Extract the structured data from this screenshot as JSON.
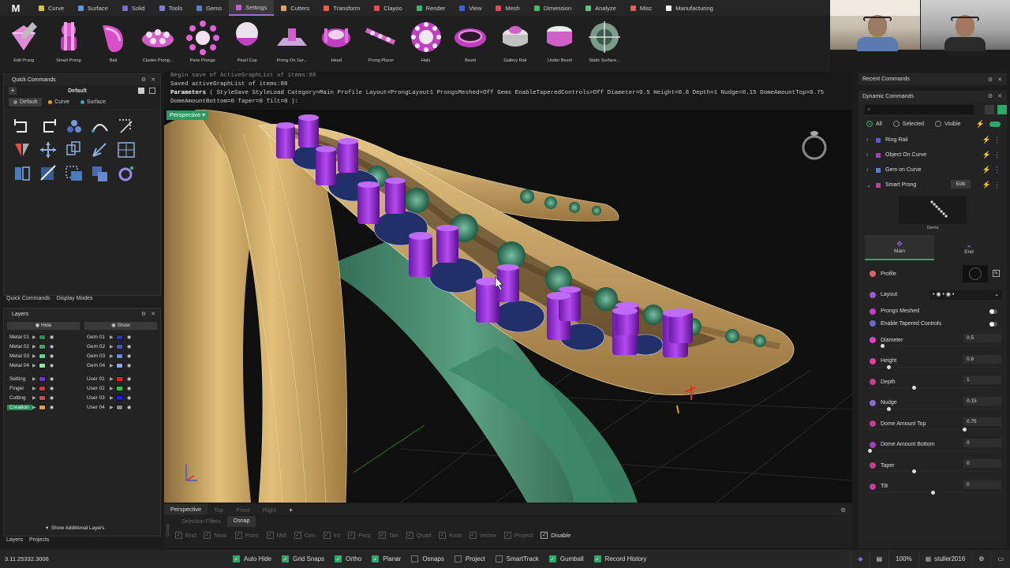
{
  "menu": {
    "logo": "M",
    "tabs": [
      {
        "label": "Curve",
        "color": "#e0c040"
      },
      {
        "label": "Surface",
        "color": "#5a9ad8"
      },
      {
        "label": "Solid",
        "color": "#7a6ad8"
      },
      {
        "label": "Tools",
        "color": "#7a7ad8"
      },
      {
        "label": "Gems",
        "color": "#5a7ad8"
      },
      {
        "label": "Settings",
        "color": "#c060d0"
      },
      {
        "label": "Cutters",
        "color": "#e0a060"
      },
      {
        "label": "Transform",
        "color": "#e06040"
      },
      {
        "label": "Clayoo",
        "color": "#e05050"
      },
      {
        "label": "Render",
        "color": "#40b070"
      },
      {
        "label": "View",
        "color": "#4060d0"
      },
      {
        "label": "Mesh",
        "color": "#d05060"
      },
      {
        "label": "Dimension",
        "color": "#40c060"
      },
      {
        "label": "Analyze",
        "color": "#60c080"
      },
      {
        "label": "Misc",
        "color": "#e06060"
      },
      {
        "label": "Manufacturing",
        "color": "#ffffff"
      }
    ],
    "active_index": 5
  },
  "ribbon": {
    "tools": [
      {
        "label": "Edit Prong",
        "icon": "edit-prong-icon"
      },
      {
        "label": "Smart Prong",
        "icon": "smart-prong-icon"
      },
      {
        "label": "Bail",
        "icon": "bail-icon"
      },
      {
        "label": "Cluster Prong...",
        "icon": "cluster-prong-icon"
      },
      {
        "label": "Pave Prongs",
        "icon": "pave-prongs-icon"
      },
      {
        "label": "Pearl Cup",
        "icon": "pearl-cup-icon"
      },
      {
        "label": "Prong On Sur...",
        "icon": "prong-on-surface-icon"
      },
      {
        "label": "Head",
        "icon": "head-icon"
      },
      {
        "label": "Prong Placer",
        "icon": "prong-placer-icon"
      },
      {
        "label": "Halo",
        "icon": "halo-icon"
      },
      {
        "label": "Bezel",
        "icon": "bezel-icon"
      },
      {
        "label": "Gallery Rail",
        "icon": "gallery-rail-icon"
      },
      {
        "label": "Under Bezel",
        "icon": "under-bezel-icon"
      },
      {
        "label": "Static Surface...",
        "icon": "static-surface-icon"
      }
    ]
  },
  "quick_commands": {
    "title": "Quick Commands",
    "preset": "Default",
    "tabs": [
      {
        "label": "Default",
        "color": "#888888"
      },
      {
        "label": "Curve",
        "color": "#e0a030"
      },
      {
        "label": "Surface",
        "color": "#3aa0c0"
      }
    ],
    "footer_tabs": [
      "Quick Commands",
      "Display Modes"
    ]
  },
  "layers": {
    "title": "Layers",
    "hide_label": "Hide",
    "show_label": "Show",
    "left": [
      {
        "name": "Metal 01",
        "color": "#2e8b57"
      },
      {
        "name": "Metal 02",
        "color": "#3aa86a"
      },
      {
        "name": "Metal 03",
        "color": "#5fd18a"
      },
      {
        "name": "Metal 04",
        "color": "#8be89f"
      },
      {
        "name": "Setting",
        "color": "#7a2ad0"
      },
      {
        "name": "Finger",
        "color": "#c04040"
      },
      {
        "name": "Cutting",
        "color": "#c05050"
      },
      {
        "name": "Creation",
        "color": "#e0a040"
      }
    ],
    "right": [
      {
        "name": "Gem 01",
        "color": "#2a3a9a"
      },
      {
        "name": "Gem 02",
        "color": "#3a5ad0"
      },
      {
        "name": "Gem 03",
        "color": "#6a8ae0"
      },
      {
        "name": "Gem 04",
        "color": "#8aaaf0"
      },
      {
        "name": "User 01",
        "color": "#e02020"
      },
      {
        "name": "User 02",
        "color": "#20d020"
      },
      {
        "name": "User 03",
        "color": "#2020e0"
      },
      {
        "name": "User 04",
        "color": "#888888"
      }
    ],
    "show_additional": "Show Additional Layers",
    "bottom_tabs": [
      "Layers",
      "Projects"
    ]
  },
  "command_line": {
    "line1": "Begin save of ActiveGraphList of items:88",
    "line2": "Saved activeGraphList of items:88",
    "param_label": "Parameters",
    "line3": "( StyleSave  StyleLoad  Category=Main  Profile  Layout=ProngLayout1  ProngsMeshed=Off  Gems  EnableTaperedControls=Off  Diameter=0.5  Height=0.8  Depth=1  Nudge=0.15  DomeAmountTop=0.75",
    "line4": "DomeAmountBottom=0  Taper=0  Tilt=0 ):"
  },
  "viewport": {
    "label": "Perspective",
    "tabs": [
      "Perspective",
      "Top",
      "Front",
      "Right"
    ],
    "add_tab": "+"
  },
  "snap_bar": {
    "tabs": [
      "Selection Filters",
      "Osnap"
    ],
    "side_label": "Osnap",
    "items": [
      {
        "label": "End",
        "on": false
      },
      {
        "label": "Near",
        "on": false
      },
      {
        "label": "Point",
        "on": false
      },
      {
        "label": "Mid",
        "on": false
      },
      {
        "label": "Cen",
        "on": false
      },
      {
        "label": "Int",
        "on": false
      },
      {
        "label": "Perp",
        "on": false
      },
      {
        "label": "Tan",
        "on": false
      },
      {
        "label": "Quad",
        "on": false
      },
      {
        "label": "Knot",
        "on": false
      },
      {
        "label": "Vertex",
        "on": false
      },
      {
        "label": "Project",
        "on": false
      },
      {
        "label": "Disable",
        "on": true
      }
    ]
  },
  "right_panel": {
    "recent_title": "Recent Commands",
    "dynamic_title": "Dynamic Commands",
    "filters": [
      {
        "label": "All",
        "on": true
      },
      {
        "label": "Selected",
        "on": false
      },
      {
        "label": "Visible",
        "on": false
      }
    ],
    "commands": [
      {
        "label": "Ring Rail",
        "color": "#5a5ad0",
        "expanded": false
      },
      {
        "label": "Object On Curve",
        "color": "#a040c0",
        "expanded": false
      },
      {
        "label": "Gem on Curve",
        "color": "#4a80d0",
        "expanded": false
      },
      {
        "label": "Smart Prong",
        "color": "#c040a0",
        "expanded": true
      }
    ],
    "edit_label": "Edit",
    "thumb_caption": "Gems",
    "main_tab": "Main",
    "end_tab": "End",
    "params": [
      {
        "label": "Profile",
        "kind": "profile",
        "icon_color": "#e06070"
      },
      {
        "label": "Layout",
        "kind": "layout",
        "icon_color": "#9a5ad0"
      },
      {
        "label": "Prongs Meshed",
        "kind": "toggle",
        "icon_color": "#c040c0"
      },
      {
        "label": "Enable Tapered Controls",
        "kind": "toggle",
        "icon_color": "#6a6ad0"
      },
      {
        "label": "Diameter",
        "value": "0.5",
        "slider": 0.1,
        "icon_color": "#e040c0"
      },
      {
        "label": "Height",
        "value": "0.8",
        "slider": 0.15,
        "icon_color": "#e040a0"
      },
      {
        "label": "Depth",
        "value": "1",
        "slider": 0.35,
        "icon_color": "#c04090"
      },
      {
        "label": "Nudge",
        "value": "0.15",
        "slider": 0.15,
        "icon_color": "#8a6ad0"
      },
      {
        "label": "Dome Amount Top",
        "value": "0.75",
        "slider": 0.75,
        "icon_color": "#c04090"
      },
      {
        "label": "Dome Amount Bottom",
        "value": "0",
        "slider": 0.0,
        "icon_color": "#a040c0"
      },
      {
        "label": "Taper",
        "value": "0",
        "slider": 0.35,
        "icon_color": "#c04090"
      },
      {
        "label": "Tilt",
        "value": "0",
        "slider": 0.5,
        "icon_color": "#c040a0"
      }
    ]
  },
  "status": {
    "version": "3.11.25332.3006",
    "items": [
      {
        "label": "Auto Hide",
        "on": true
      },
      {
        "label": "Grid Snaps",
        "on": true
      },
      {
        "label": "Ortho",
        "on": true
      },
      {
        "label": "Planar",
        "on": true
      },
      {
        "label": "Osnaps",
        "on": false
      },
      {
        "label": "Project",
        "on": false
      },
      {
        "label": "SmartTrack",
        "on": false
      },
      {
        "label": "Gumball",
        "on": true
      },
      {
        "label": "Record History",
        "on": true
      }
    ],
    "zoom": "100%",
    "user": "stuller2016"
  },
  "colors": {
    "accent": "#2aa86a",
    "gold": "#d8b36a",
    "prong": "#9a2ad8",
    "gem": "#2a3a8a",
    "green_gem": "#3a8a6a"
  }
}
